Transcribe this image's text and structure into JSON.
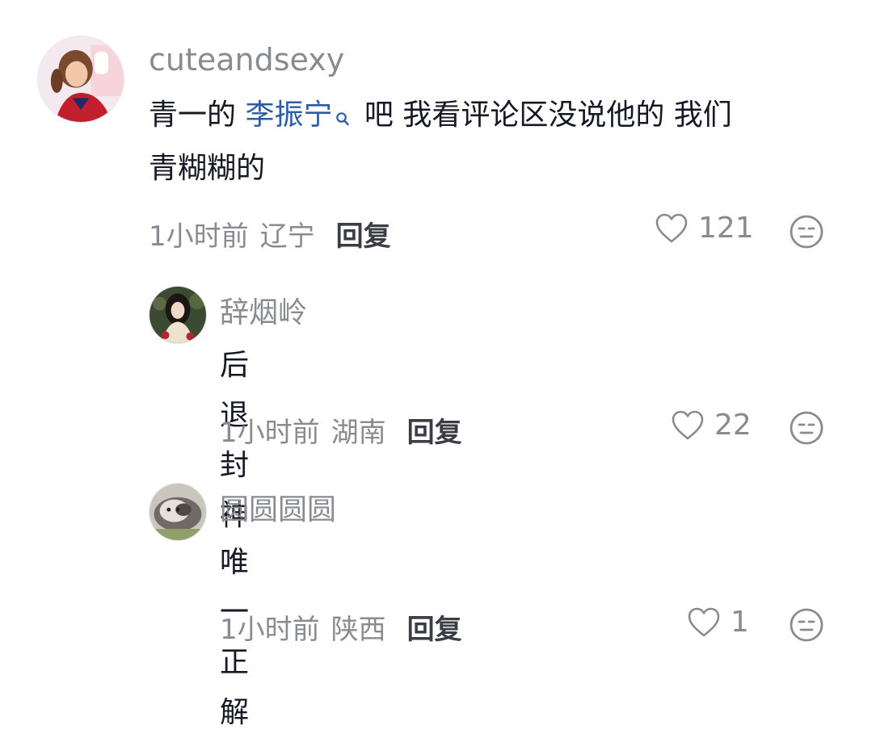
{
  "comments": [
    {
      "username": "cuteandsexy",
      "text_before": "青一的 ",
      "mention": "李振宁",
      "text_after": " 吧 我看评论区没说他的 我们",
      "text_line2": "青糊糊的",
      "time": "1小时前",
      "region": "辽宁",
      "reply_label": "回复",
      "likes": "121"
    },
    {
      "username": "辞烟岭",
      "text": "后退封神",
      "time": "1小时前",
      "region": "湖南",
      "reply_label": "回复",
      "likes": "22"
    },
    {
      "username": "圆圆圆圆",
      "text": "唯一正解",
      "time": "1小时前",
      "region": "陕西",
      "reply_label": "回复",
      "likes": "1"
    }
  ],
  "icons": {
    "like": "heart-outline-icon",
    "dislike": "unimpressed-face-icon",
    "mention": "search-icon"
  },
  "colors": {
    "mention": "#2a5ca8",
    "secondary_text": "#8a8b91",
    "primary_text": "#161823"
  }
}
